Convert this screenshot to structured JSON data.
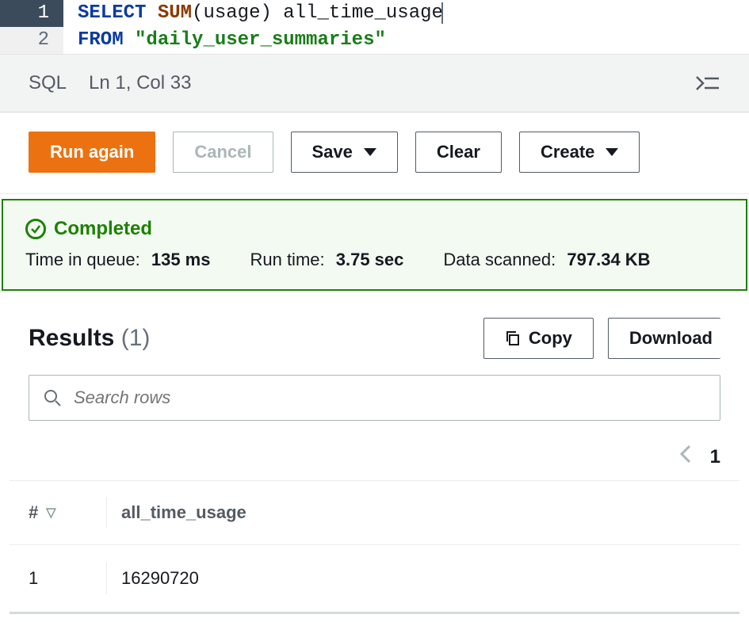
{
  "editor": {
    "lines": [
      {
        "num": "1",
        "tokens": [
          {
            "cls": "kw",
            "t": "SELECT"
          },
          {
            "cls": "txt",
            "t": " "
          },
          {
            "cls": "fn",
            "t": "SUM"
          },
          {
            "cls": "txt",
            "t": "("
          },
          {
            "cls": "txt",
            "t": "usage"
          },
          {
            "cls": "txt",
            "t": ") "
          },
          {
            "cls": "txt",
            "t": "all_time_usage"
          }
        ],
        "active": true
      },
      {
        "num": "2",
        "tokens": [
          {
            "cls": "kw",
            "t": "FROM"
          },
          {
            "cls": "txt",
            "t": " "
          },
          {
            "cls": "str",
            "t": "\"daily_user_summaries\""
          }
        ],
        "active": false
      }
    ]
  },
  "status": {
    "mode": "SQL",
    "position": "Ln 1, Col 33"
  },
  "actions": {
    "run": "Run again",
    "cancel": "Cancel",
    "save": "Save",
    "clear": "Clear",
    "create": "Create"
  },
  "banner": {
    "title": "Completed",
    "queue_label": "Time in queue:",
    "queue_value": "135 ms",
    "runtime_label": "Run time:",
    "runtime_value": "3.75 sec",
    "scanned_label": "Data scanned:",
    "scanned_value": "797.34 KB"
  },
  "results": {
    "heading": "Results",
    "count": "(1)",
    "copy": "Copy",
    "download": "Download",
    "search_placeholder": "Search rows",
    "page": "1",
    "columns": {
      "idx": "#",
      "col1": "all_time_usage"
    },
    "rows": [
      {
        "idx": "1",
        "col1": "16290720"
      }
    ]
  }
}
